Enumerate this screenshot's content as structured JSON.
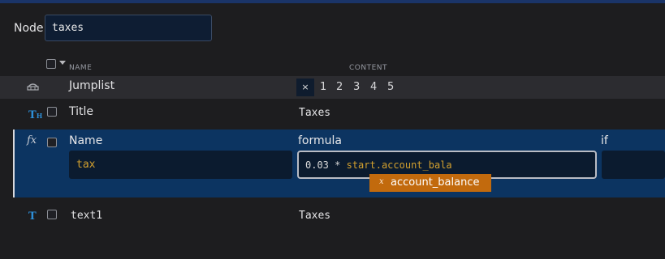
{
  "node": {
    "label": "Node",
    "value": "taxes"
  },
  "columns": {
    "name": "NAME",
    "content": "CONTENT"
  },
  "jumplist": {
    "label": "Jumplist",
    "clear": "×",
    "pages": [
      "1",
      "2",
      "3",
      "4",
      "5"
    ]
  },
  "title_row": {
    "label": "Title",
    "value": "Taxes"
  },
  "formula_row": {
    "headers": {
      "name": "Name",
      "formula": "formula",
      "if": "if"
    },
    "name_value": "tax",
    "formula_number": "0.03",
    "formula_op": "*",
    "formula_ident": "start.account_bala",
    "suggestion": "account_balance"
  },
  "text_row": {
    "label": "text1",
    "value": "Taxes"
  },
  "icons": {
    "jumplist": "jumplist-icon",
    "title": "title-icon",
    "formula": "formula-icon",
    "text": "text-icon",
    "suggestion": "variable-icon"
  },
  "colors": {
    "accent": "#0c3461",
    "suggestion": "#c26a0d",
    "identifier": "#d3a02e"
  }
}
